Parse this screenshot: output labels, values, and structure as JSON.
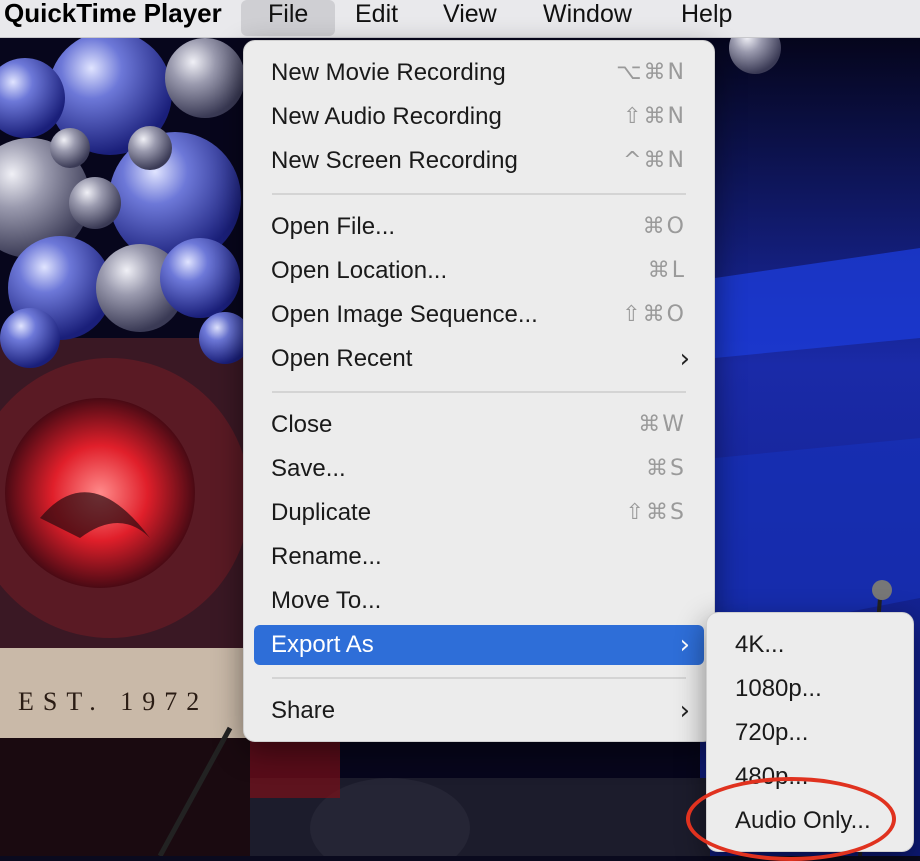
{
  "menubar": {
    "app_name": "QuickTime Player",
    "items": [
      "File",
      "Edit",
      "View",
      "Window",
      "Help"
    ]
  },
  "background": {
    "sign_text": "EST. 1972"
  },
  "file_menu": {
    "groups": [
      [
        {
          "label": "New Movie Recording",
          "shortcut": "⌥⌘N"
        },
        {
          "label": "New Audio Recording",
          "shortcut": "⇧⌘N"
        },
        {
          "label": "New Screen Recording",
          "shortcut": "^⌘N"
        }
      ],
      [
        {
          "label": "Open File...",
          "shortcut": "⌘O"
        },
        {
          "label": "Open Location...",
          "shortcut": "⌘L"
        },
        {
          "label": "Open Image Sequence...",
          "shortcut": "⇧⌘O"
        },
        {
          "label": "Open Recent",
          "submenu": true
        }
      ],
      [
        {
          "label": "Close",
          "shortcut": "⌘W"
        },
        {
          "label": "Save...",
          "shortcut": "⌘S"
        },
        {
          "label": "Duplicate",
          "shortcut": "⇧⌘S"
        },
        {
          "label": "Rename..."
        },
        {
          "label": "Move To..."
        },
        {
          "label": "Export As",
          "submenu": true,
          "highlighted": true
        }
      ],
      [
        {
          "label": "Share",
          "submenu": true
        }
      ]
    ]
  },
  "export_submenu": {
    "items": [
      "4K...",
      "1080p...",
      "720p...",
      "480p...",
      "Audio Only..."
    ]
  },
  "colors": {
    "highlight": "#2e6ed8",
    "annotation": "#e0321f"
  }
}
